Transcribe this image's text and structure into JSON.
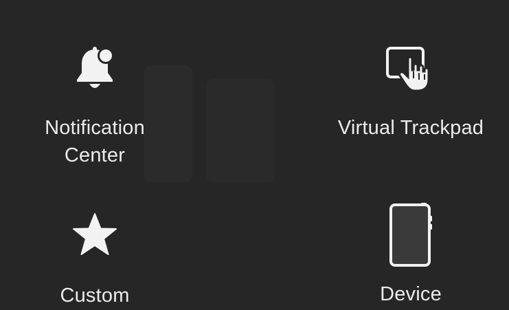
{
  "menu": {
    "items": [
      {
        "label_lines": [
          "Notification",
          "Center"
        ],
        "icon": "bell-icon"
      },
      {
        "label_lines": [
          "Virtual Trackpad"
        ],
        "icon": "trackpad-icon"
      },
      {
        "label_lines": [
          "Custom"
        ],
        "icon": "star-icon"
      },
      {
        "label_lines": [
          "Device"
        ],
        "icon": "device-icon"
      }
    ]
  },
  "colors": {
    "background": "#262626",
    "foreground": "#f2f2f2",
    "device_fill": "#3a3a3a"
  }
}
